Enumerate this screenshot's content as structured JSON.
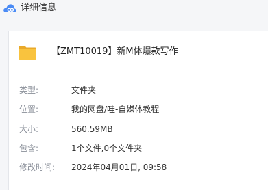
{
  "window": {
    "title": "详细信息",
    "icon": "cloud-icon"
  },
  "file": {
    "icon": "folder-icon",
    "name": "【ZMT10019】新M体爆款写作"
  },
  "details": {
    "type_label": "类型:",
    "type_value": "文件夹",
    "location_label": "位置:",
    "location_value": "我的网盘/哇-自媒体教程",
    "size_label": "大小:",
    "size_value": "560.59MB",
    "contains_label": "包含:",
    "contains_value": "1个文件,0个文件夹",
    "modified_label": "修改时间:",
    "modified_value": "2024年04月01日, 09:58"
  },
  "colors": {
    "accent_blue": "#4a8bf5",
    "folder_yellow": "#f9c33e",
    "label_gray": "#8a8f99",
    "value_dark": "#333333",
    "window_bg": "#f5f6f8",
    "panel_bg": "#ffffff"
  }
}
